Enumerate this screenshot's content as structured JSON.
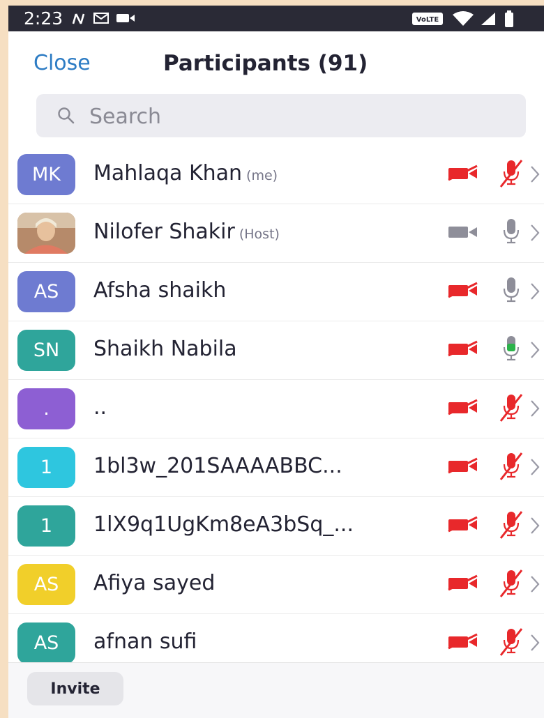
{
  "status_bar": {
    "time": "2:23",
    "icons": [
      "n-signal-icon",
      "gmail-icon",
      "video-icon",
      "volte-icon",
      "wifi-icon",
      "cell-signal-icon",
      "battery-icon"
    ],
    "volte_label": "VoLTE"
  },
  "header": {
    "close_label": "Close",
    "title": "Participants (91)"
  },
  "search": {
    "placeholder": "Search"
  },
  "participants": [
    {
      "initials": "MK",
      "name": "Mahlaqa Khan",
      "tag": "(me)",
      "avatar_color": "#6e7bd1",
      "video": "off",
      "audio": "muted"
    },
    {
      "initials": "",
      "name": "Nilofer Shakir",
      "tag": "(Host)",
      "avatar_color": "#c9a07e",
      "avatar_type": "photo",
      "video": "unavailable",
      "audio": "unmuted"
    },
    {
      "initials": "AS",
      "name": "Afsha shaikh",
      "tag": "",
      "avatar_color": "#6e7bd1",
      "video": "off",
      "audio": "unmuted"
    },
    {
      "initials": "SN",
      "name": "Shaikh Nabila",
      "tag": "",
      "avatar_color": "#2fa59b",
      "video": "off",
      "audio": "speaking"
    },
    {
      "initials": ".",
      "name": "..",
      "tag": "",
      "avatar_color": "#8d5fd3",
      "video": "off",
      "audio": "muted"
    },
    {
      "initials": "1",
      "name": "1bl3w_201SAAAABBC...",
      "tag": "",
      "avatar_color": "#2ec6df",
      "video": "off",
      "audio": "muted"
    },
    {
      "initials": "1",
      "name": "1lX9q1UgKm8eA3bSq_...",
      "tag": "",
      "avatar_color": "#2fa59b",
      "video": "off",
      "audio": "muted"
    },
    {
      "initials": "AS",
      "name": "Afiya sayed",
      "tag": "",
      "avatar_color": "#f1cf2a",
      "video": "off",
      "audio": "muted"
    },
    {
      "initials": "AS",
      "name": "afnan sufi",
      "tag": "",
      "avatar_color": "#2fa59b",
      "video": "off",
      "audio": "muted"
    }
  ],
  "footer": {
    "invite_label": "Invite"
  },
  "colors": {
    "accent": "#2d7cc4",
    "muted_red": "#e8282b",
    "speaking_green": "#2bb34a",
    "icon_gray": "#8e8e99"
  }
}
